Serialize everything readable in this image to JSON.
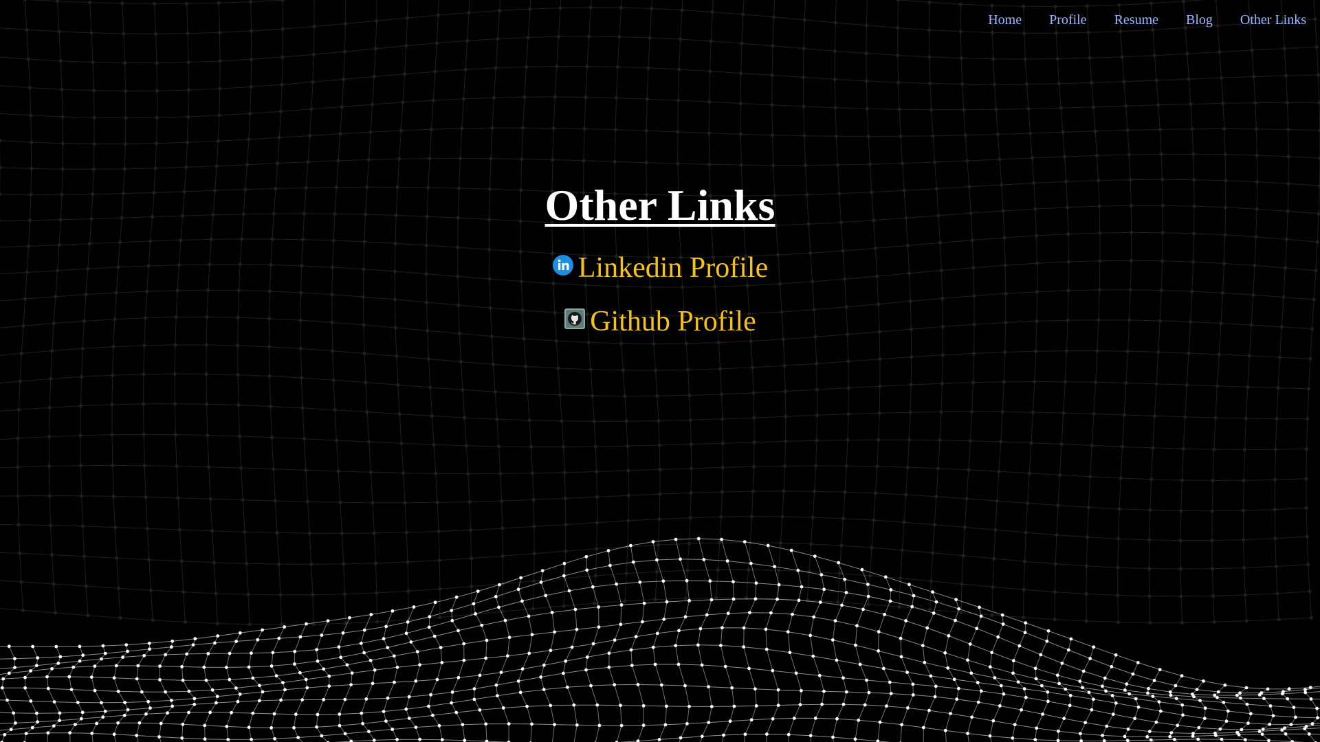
{
  "nav": {
    "items": [
      {
        "label": "Home"
      },
      {
        "label": "Profile"
      },
      {
        "label": "Resume"
      },
      {
        "label": "Blog"
      },
      {
        "label": "Other Links"
      }
    ]
  },
  "main": {
    "title": "Other Links",
    "links": [
      {
        "label": "Linkedin Profile",
        "icon": "linkedin-icon"
      },
      {
        "label": "Github Profile",
        "icon": "github-icon"
      }
    ]
  },
  "colors": {
    "background": "#000000",
    "nav_link": "#9ab8ff",
    "title": "#ffffff",
    "link": "#f4c21b",
    "linkedin": "#1d8fe0",
    "mesh": "#ffffff"
  }
}
